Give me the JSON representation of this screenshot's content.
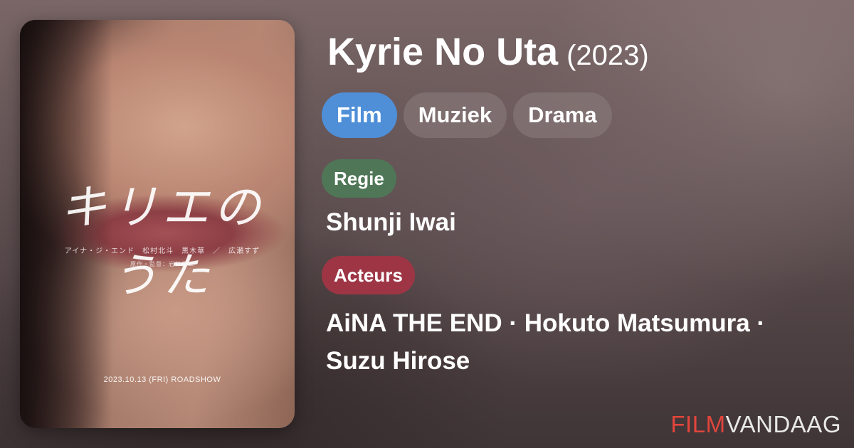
{
  "movie": {
    "title": "Kyrie No Uta",
    "year": "(2023)"
  },
  "genres": [
    {
      "label": "Film",
      "color": "#4f8fd8"
    },
    {
      "label": "Muziek"
    },
    {
      "label": "Drama"
    }
  ],
  "director": {
    "label": "Regie",
    "label_color": "#4f7757",
    "name": "Shunji Iwai"
  },
  "actors": {
    "label": "Acteurs",
    "label_color": "#9e3545",
    "line1": "AiNA THE END · Hokuto Matsumura ·",
    "line2": "Suzu Hirose"
  },
  "poster": {
    "title_text": "キリエのうた",
    "cast_text": "アイナ・ジ・エンド　松村北斗　黒木華　／　広瀬すず",
    "credit_text": "原作・監督：岩井俊二",
    "release_text": "2023.10.13 (FRI) ROADSHOW"
  },
  "brand": {
    "part1": "FILM",
    "part2": "VANDAAG",
    "accent_color": "#e2453c"
  }
}
